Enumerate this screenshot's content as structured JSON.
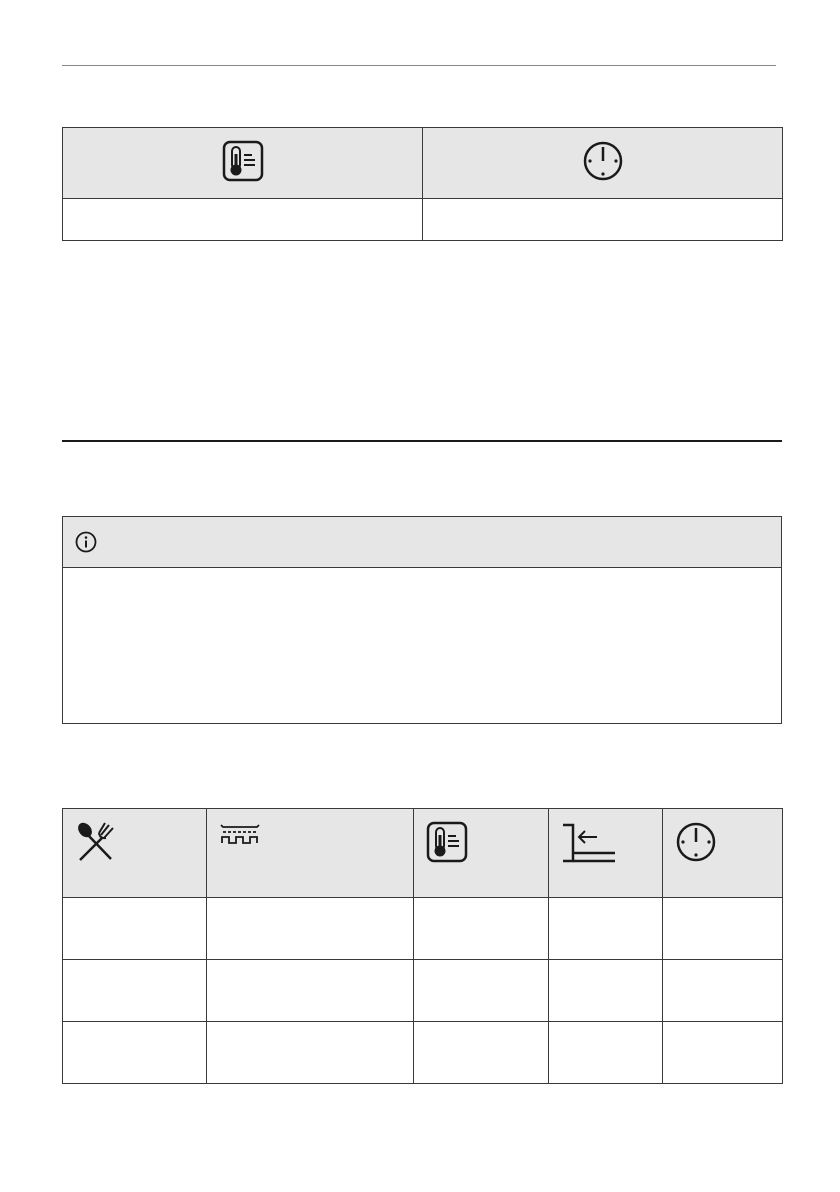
{
  "header_table": {
    "columns": [
      {
        "icon": "thermometer-icon",
        "label": ""
      },
      {
        "icon": "clock-icon",
        "label": ""
      }
    ],
    "rows": [
      [
        "",
        ""
      ]
    ]
  },
  "info_box": {
    "icon": "info-icon",
    "text": ""
  },
  "cooking_table": {
    "columns": [
      {
        "icon": "food-spoon-fork-icon",
        "label": ""
      },
      {
        "icon": "heating-function-icon",
        "label": ""
      },
      {
        "icon": "thermometer-icon",
        "label": ""
      },
      {
        "icon": "shelf-position-icon",
        "label": ""
      },
      {
        "icon": "clock-icon",
        "label": ""
      }
    ],
    "rows": [
      [
        "",
        "",
        "",
        "",
        ""
      ],
      [
        "",
        "",
        "",
        "",
        ""
      ],
      [
        "",
        "",
        "",
        "",
        ""
      ]
    ]
  }
}
